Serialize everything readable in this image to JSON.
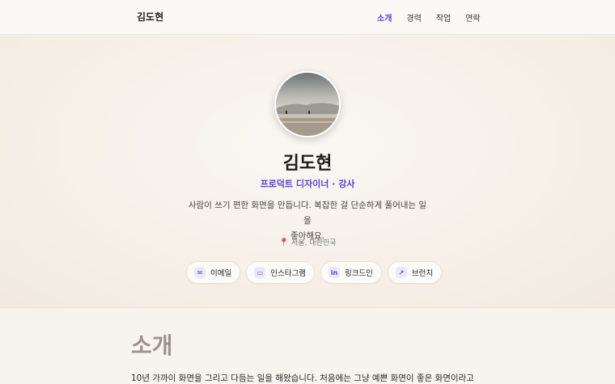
{
  "nav": {
    "brand": "김도현",
    "links": [
      "소개",
      "경력",
      "작업",
      "연락"
    ],
    "active": 0
  },
  "profile": {
    "name": "김도현",
    "role": "프로덕트 디자이너 · 강사",
    "bio_line1": "사람이 쓰기 편한 화면을 만듭니다. 복잡한 걸 단순하게 풀어내는 일을",
    "bio_line2": "좋아해요.",
    "location": "서울, 대한민국"
  },
  "contacts": [
    {
      "label": "이메일",
      "icon": "mail-icon",
      "glyph": "✉"
    },
    {
      "label": "인스타그램",
      "icon": "instagram-icon",
      "glyph": "▭"
    },
    {
      "label": "링크드인",
      "icon": "linkedin-icon",
      "glyph": "in"
    },
    {
      "label": "브런치",
      "icon": "external-link-icon",
      "glyph": "↗"
    }
  ],
  "about": {
    "title": "소개",
    "text": "10년 가까이 화면을 그리고 다듬는 일을 해왔습니다. 처음에는 그냥 예쁜 화면이 좋은 화면이라고"
  },
  "colors": {
    "accent": "#5b3fd6",
    "background": "#f6f1ea",
    "pin": "#e0475b"
  }
}
